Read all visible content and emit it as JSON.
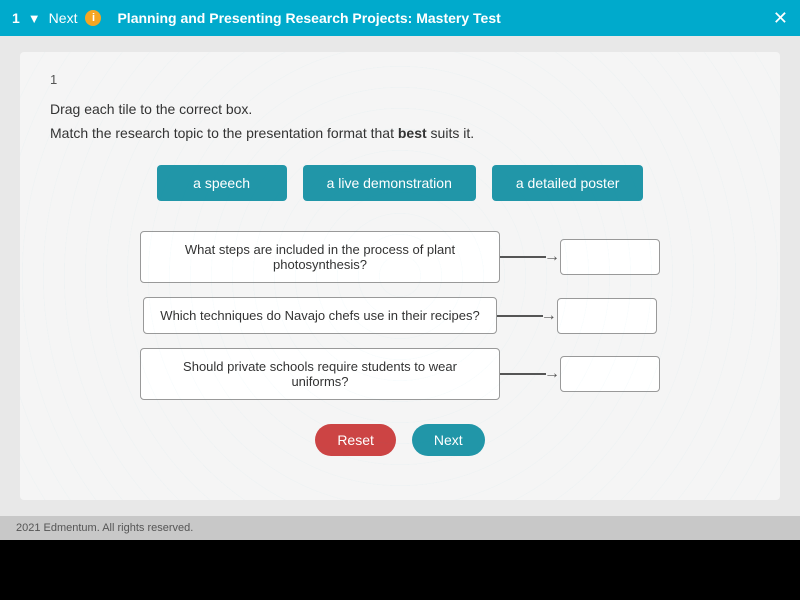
{
  "topbar": {
    "question_number": "1",
    "nav_next": "Next",
    "nav_info": "i",
    "title": "Planning and Presenting Research Projects: Mastery Test",
    "close": "✕"
  },
  "question": {
    "number": "1",
    "instruction1": "Drag each tile to the correct box.",
    "instruction2_prefix": "Match the research topic to the presentation format that ",
    "instruction2_bold": "best",
    "instruction2_suffix": " suits it.",
    "tiles": [
      {
        "id": "tile-speech",
        "label": "a speech"
      },
      {
        "id": "tile-demo",
        "label": "a live demonstration"
      },
      {
        "id": "tile-poster",
        "label": "a detailed poster"
      }
    ],
    "rows": [
      {
        "id": "row-1",
        "text": "What steps are included in the process of plant photosynthesis?"
      },
      {
        "id": "row-2",
        "text": "Which techniques do Navajo chefs use in their recipes?"
      },
      {
        "id": "row-3",
        "text": "Should private schools require students to wear uniforms?"
      }
    ],
    "reset_label": "Reset",
    "next_label": "Next"
  },
  "footer": {
    "text": "2021 Edmentum. All rights reserved."
  }
}
